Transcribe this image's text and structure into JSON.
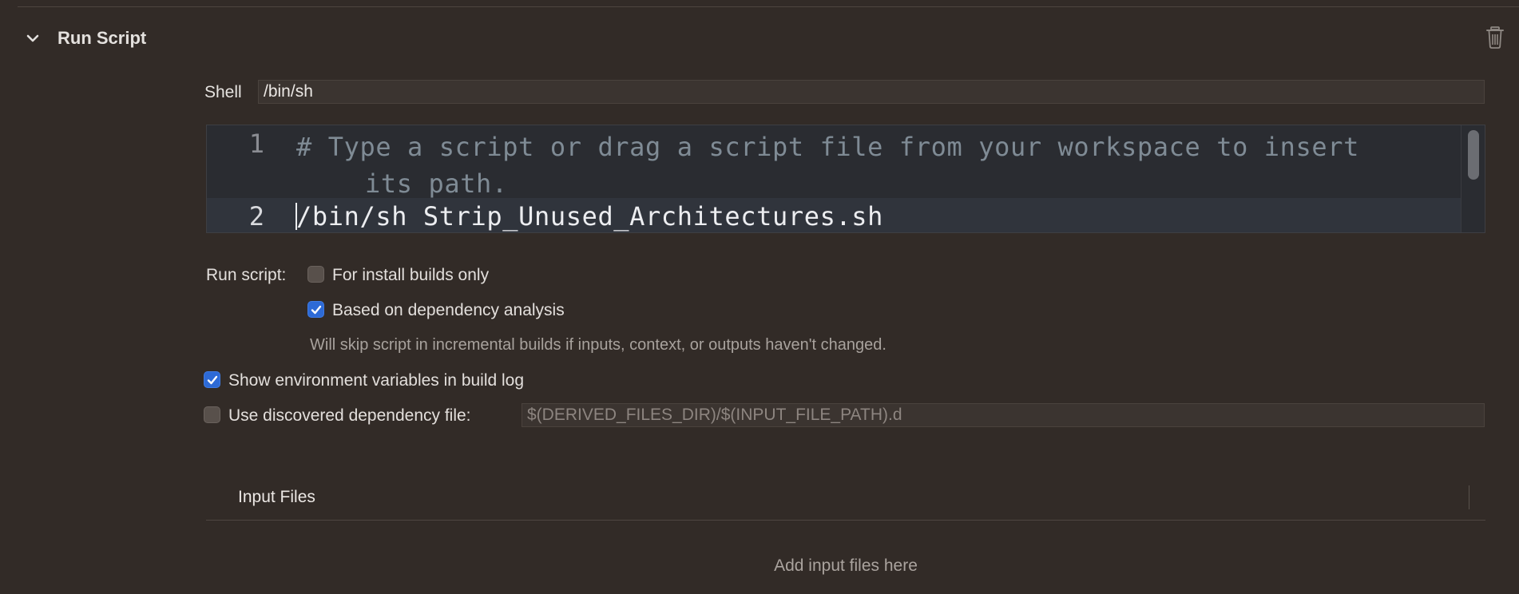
{
  "phase": {
    "title": "Run Script",
    "expanded": true
  },
  "shell": {
    "label": "Shell",
    "value": "/bin/sh"
  },
  "editor": {
    "lines": [
      {
        "number": "1",
        "text": "# Type a script or drag a script file from your workspace to insert",
        "continuation": "its path."
      },
      {
        "number": "2",
        "text": "/bin/sh Strip_Unused_Architectures.sh"
      }
    ]
  },
  "run_script": {
    "label": "Run script:",
    "install_builds_only": {
      "label": "For install builds only",
      "checked": false
    },
    "dependency_analysis": {
      "label": "Based on dependency analysis",
      "checked": true
    },
    "note": "Will skip script in incremental builds if inputs, context, or outputs haven't changed."
  },
  "show_env_vars": {
    "label": "Show environment variables in build log",
    "checked": true
  },
  "discovered_dependency": {
    "label": "Use discovered dependency file:",
    "checked": false,
    "placeholder": "$(DERIVED_FILES_DIR)/$(INPUT_FILE_PATH).d"
  },
  "input_files": {
    "title": "Input Files",
    "empty_hint": "Add input files here"
  },
  "colors": {
    "background": "#322b27",
    "accent": "#2d6ad6",
    "editor_background": "#2a2c31"
  },
  "icons": {
    "collapse": "chevron-down-icon",
    "delete": "trash-icon",
    "check": "checkmark-icon"
  }
}
